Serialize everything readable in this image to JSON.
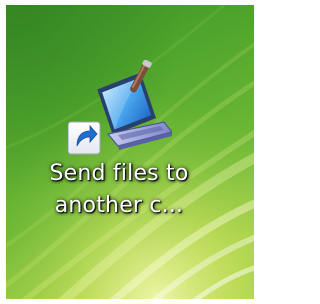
{
  "desktop": {
    "icon": {
      "name": "send-files-icon",
      "shortcut_overlay": "shortcut-arrow-icon",
      "label_line1": "Send files to",
      "label_line2": "another c..."
    }
  },
  "colors": {
    "wallpaper_base": "#3f9a2a",
    "wallpaper_light": "#d6ea6a",
    "label_text": "#ffffff",
    "shortcut_blue": "#1f6fd0"
  }
}
